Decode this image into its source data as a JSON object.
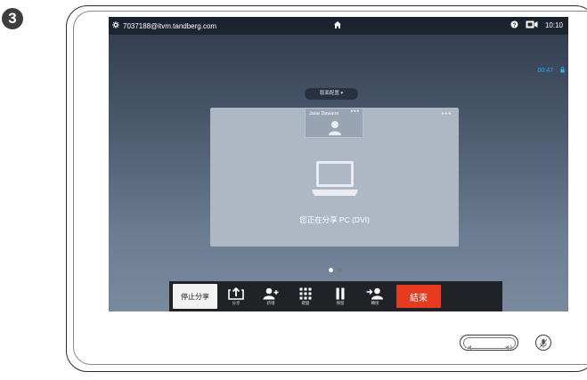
{
  "step": {
    "number": "3"
  },
  "statusbar": {
    "gear_icon": "gear-icon",
    "address": "7037188@itvm.tandberg.com",
    "home_icon": "home-icon",
    "help_icon": "help-icon",
    "camera_icon": "camera-icon",
    "time": "10:10"
  },
  "call": {
    "duration": "00:47",
    "lock_icon": "lock-icon",
    "color": "#3aa7e8"
  },
  "layout_button": {
    "label": "版面配置 ▾"
  },
  "self_view": {
    "name": "Jane Dawson",
    "menu": "•••"
  },
  "share_panel": {
    "menu": "•••",
    "message": "您正在分享 PC (DVI)"
  },
  "pager": {
    "count": 2,
    "active": 0
  },
  "toolbar": {
    "stop_share_label": "停止分享",
    "share_label": "分享",
    "add_label": "新增",
    "keypad_label": "鍵盤",
    "hold_label": "保留",
    "transfer_label": "轉接",
    "end_label": "結束",
    "end_color": "#e83a1f"
  },
  "hardware": {
    "volume_icon": "volume-icon",
    "mute_icon": "microphone-mute-icon"
  }
}
